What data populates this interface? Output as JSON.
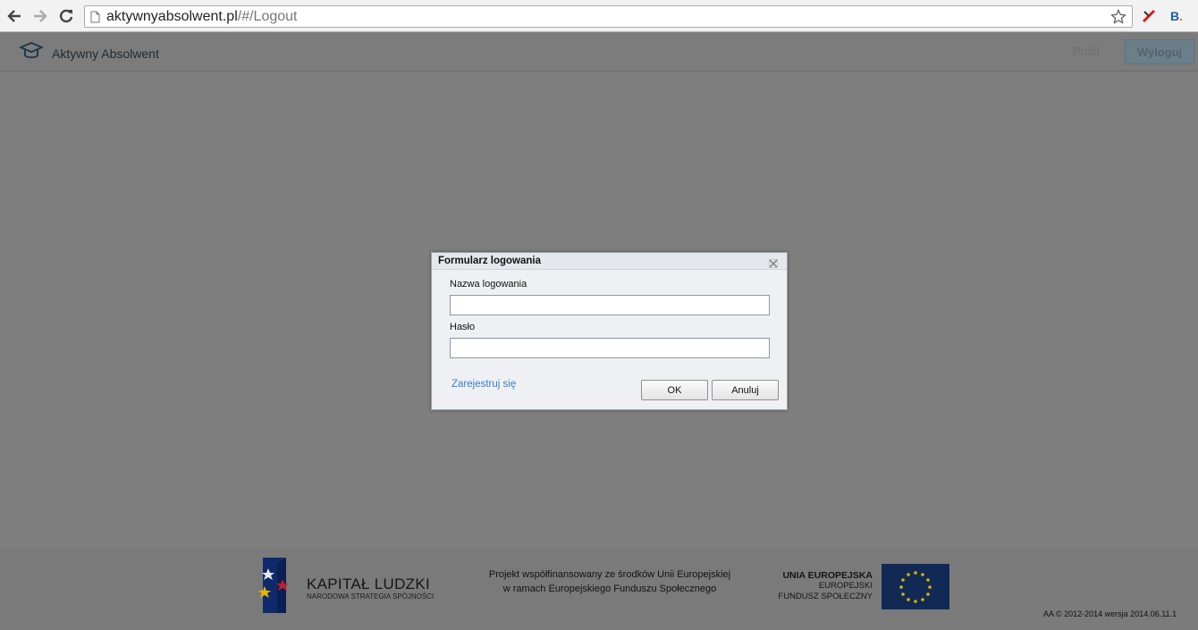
{
  "browser": {
    "url_domain": "aktywnyabsolwent.pl",
    "url_path": "/#/Logout"
  },
  "header": {
    "brand_name": "Aktywny Absolwent",
    "nav_profile": "Profil",
    "logout_label": "Wyloguj"
  },
  "dialog": {
    "title": "Formularz logowania",
    "username_label": "Nazwa logowania",
    "username_value": "",
    "password_label": "Hasło",
    "password_value": "",
    "register_link": "Zarejestruj się",
    "ok_label": "OK",
    "cancel_label": "Anuluj"
  },
  "footer": {
    "kl_title": "KAPITAŁ LUDZKI",
    "kl_subtitle": "NARODOWA STRATEGIA SPÓJNOŚCI",
    "project_line1": "Projekt współfinansowany ze środków Unii Europejskiej",
    "project_line2": "w ramach Europejskiego Funduszu Społecznego",
    "ue_title": "UNIA EUROPEJSKA",
    "ue_line2": "EUROPEJSKI",
    "ue_line3": "FUNDUSZ SPOŁECZNY",
    "copyright": "AA © 2012-2014 wersja 2014.06.11.1"
  },
  "colors": {
    "overlay": "#7f7f7f",
    "link": "#3a7fc4",
    "eu_blue": "#102a55",
    "eu_star": "#ffcc00"
  }
}
